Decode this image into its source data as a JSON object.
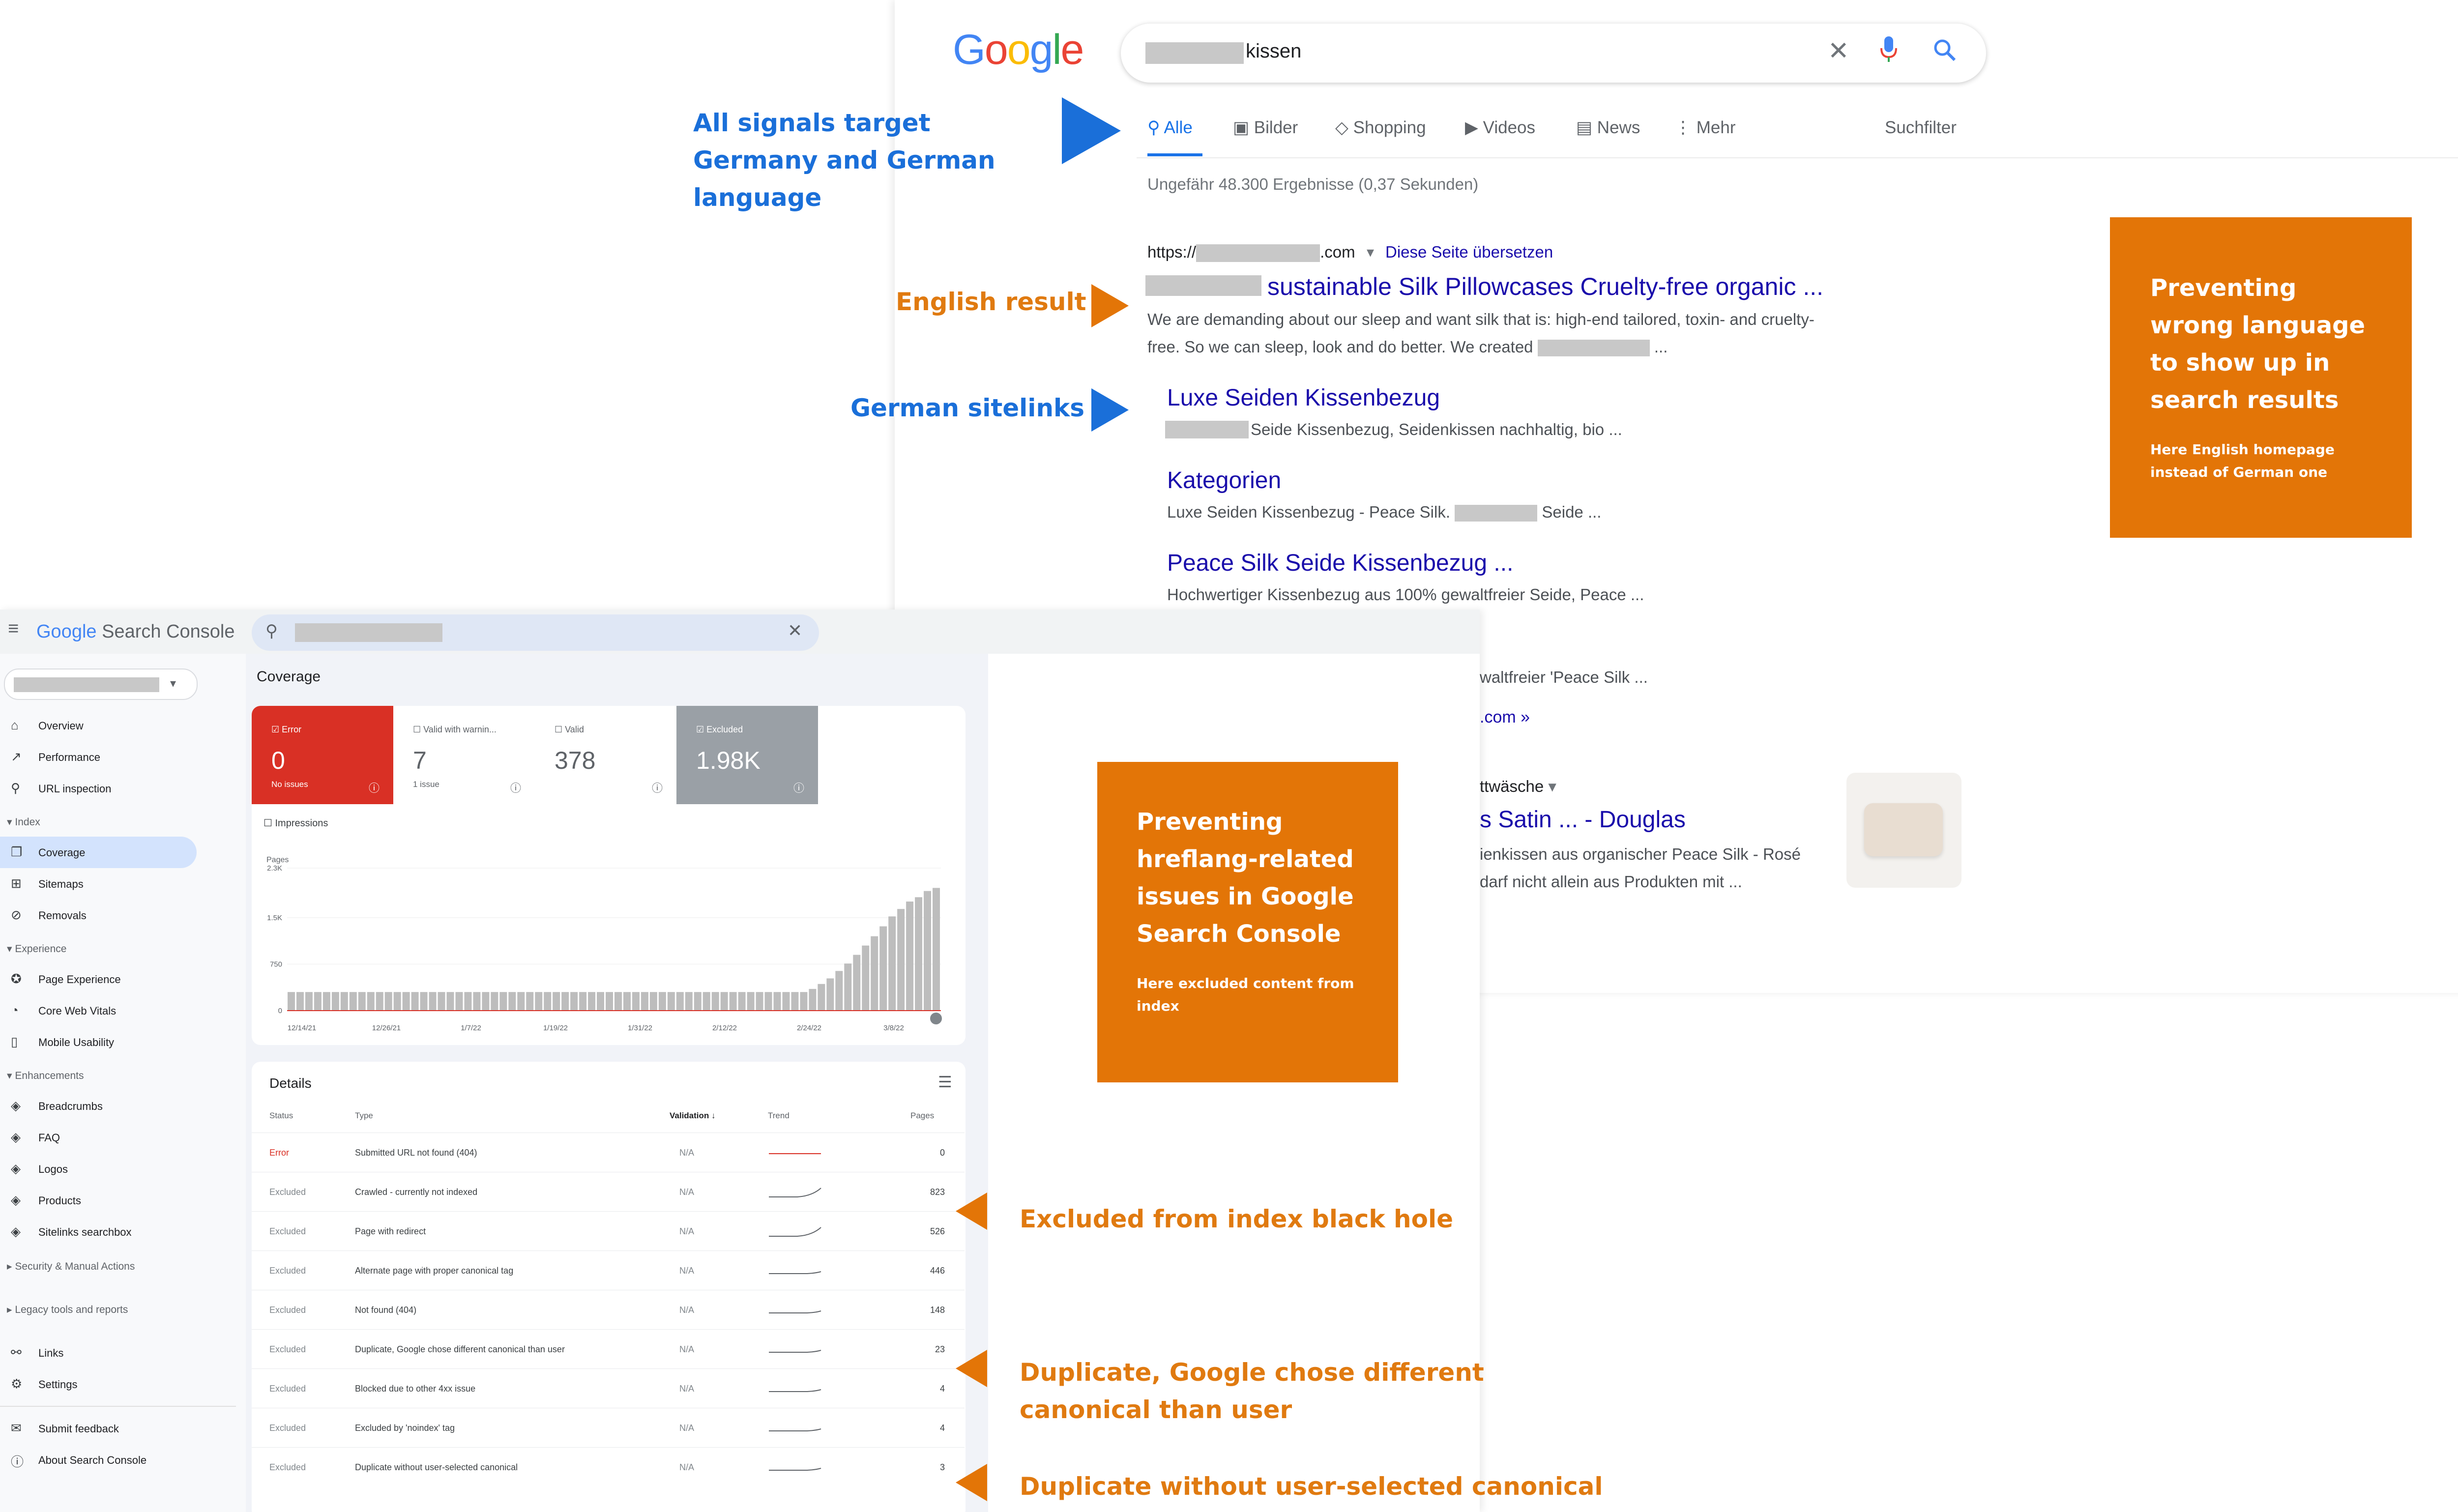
{
  "annotations": {
    "signals": "All signals target Germany and German language",
    "english_result": "English result",
    "german_sitelinks": "German sitelinks",
    "excluded_black_hole": "Excluded from index black hole",
    "duplicate_google_canonical": "Duplicate, Google chose different canonical than user",
    "duplicate_without_canonical": "Duplicate without user-selected canonical",
    "box_language": {
      "title": "Preventing wrong language to show up in search results",
      "subtitle": "Here English homepage instead of German one"
    },
    "box_hreflang": {
      "title": "Preventing hreflang-related issues in Google Search Console",
      "subtitle": "Here excluded content from index"
    }
  },
  "serp": {
    "logo": "Google",
    "query": "kissen",
    "tabs": [
      {
        "label": "Alle",
        "icon": "search-icon"
      },
      {
        "label": "Bilder",
        "icon": "image-icon"
      },
      {
        "label": "Shopping",
        "icon": "tag-icon"
      },
      {
        "label": "Videos",
        "icon": "video-icon"
      },
      {
        "label": "News",
        "icon": "news-icon"
      },
      {
        "label": "Mehr",
        "icon": "more-vert-icon"
      }
    ],
    "filter_label": "Suchfilter",
    "result_stats": "Ungefähr 48.300 Ergebnisse (0,37 Sekunden)",
    "result": {
      "url_prefix": "https://",
      "url_suffix": ".com",
      "translate": "Diese Seite übersetzen",
      "title": "sustainable Silk Pillowcases Cruelty-free organic ...",
      "snippet_line1": "We are demanding about our sleep and want silk that is: high-end tailored, toxin- and cruelty-",
      "snippet_line2": "free. So we can sleep, look and do better. We created",
      "snippet_end": "..."
    },
    "sitelinks": [
      {
        "title": "Luxe Seiden Kissenbezug",
        "desc": "Seide Kissenbezug, Seidenkissen nachhaltig, bio ..."
      },
      {
        "title": "Kategorien",
        "desc_a": "Luxe Seiden Kissenbezug - Peace Silk.",
        "desc_b": "Seide ..."
      },
      {
        "title": "Peace Silk Seide Kissenbezug ...",
        "desc": "Hochwertiger Kissenbezug aus 100% gewaltfreier Seide, Peace ..."
      }
    ],
    "partial": {
      "line1": "waltfreier 'Peace Silk ...",
      "line2": ".com »",
      "line3": "ttwäsche",
      "line4": "s Satin ... - Douglas",
      "line5": "ienkissen aus organischer Peace Silk - Rosé",
      "line6": "darf nicht allein aus Produkten mit ..."
    }
  },
  "gsc": {
    "brand_google": "Google",
    "brand_product": "Search Console",
    "nav_top": [
      {
        "label": "Overview",
        "icon": "home-icon"
      },
      {
        "label": "Performance",
        "icon": "trending-up-icon"
      },
      {
        "label": "URL inspection",
        "icon": "search-icon"
      }
    ],
    "section_index": "Index",
    "nav_index": [
      {
        "label": "Coverage",
        "icon": "file-copy-icon"
      },
      {
        "label": "Sitemaps",
        "icon": "sitemap-icon"
      },
      {
        "label": "Removals",
        "icon": "eye-off-icon"
      }
    ],
    "section_experience": "Experience",
    "nav_experience": [
      {
        "label": "Page Experience",
        "icon": "star-circle-icon"
      },
      {
        "label": "Core Web Vitals",
        "icon": "speed-icon"
      },
      {
        "label": "Mobile Usability",
        "icon": "phone-icon"
      }
    ],
    "section_enhancements": "Enhancements",
    "nav_enhancements": [
      {
        "label": "Breadcrumbs",
        "icon": "layers-icon"
      },
      {
        "label": "FAQ",
        "icon": "layers-icon"
      },
      {
        "label": "Logos",
        "icon": "layers-icon"
      },
      {
        "label": "Products",
        "icon": "layers-icon"
      },
      {
        "label": "Sitelinks searchbox",
        "icon": "layers-icon"
      }
    ],
    "section_security": "Security & Manual Actions",
    "section_legacy": "Legacy tools and reports",
    "nav_bottom": [
      {
        "label": "Links",
        "icon": "links-icon"
      },
      {
        "label": "Settings",
        "icon": "gear-icon"
      }
    ],
    "nav_footer": [
      {
        "label": "Submit feedback",
        "icon": "feedback-icon"
      },
      {
        "label": "About Search Console",
        "icon": "info-icon"
      }
    ],
    "page_title": "Coverage",
    "tiles": [
      {
        "label": "Error",
        "value": "0",
        "sub": "No issues",
        "checked": true
      },
      {
        "label": "Valid with warnin...",
        "value": "7",
        "sub": "1 issue",
        "checked": false
      },
      {
        "label": "Valid",
        "value": "378",
        "sub": "",
        "checked": false
      },
      {
        "label": "Excluded",
        "value": "1.98K",
        "sub": "",
        "checked": true
      }
    ],
    "impressions_label": "Impressions",
    "chart_data": {
      "type": "bar",
      "ylabel": "Pages",
      "ylim": [
        0,
        2300
      ],
      "yticks": [
        "2.3K",
        "1.5K",
        "750",
        "0"
      ],
      "xticks": [
        "12/14/21",
        "12/26/21",
        "1/7/22",
        "1/19/22",
        "1/31/22",
        "2/12/22",
        "2/24/22",
        "3/8/22"
      ],
      "values": [
        300,
        300,
        300,
        300,
        300,
        300,
        300,
        300,
        300,
        300,
        300,
        300,
        300,
        300,
        300,
        300,
        300,
        300,
        300,
        300,
        300,
        300,
        300,
        300,
        300,
        300,
        300,
        300,
        300,
        300,
        300,
        300,
        300,
        300,
        300,
        300,
        300,
        300,
        300,
        300,
        300,
        300,
        300,
        300,
        300,
        300,
        300,
        300,
        300,
        300,
        300,
        300,
        300,
        300,
        300,
        300,
        300,
        300,
        300,
        350,
        430,
        520,
        640,
        760,
        900,
        1050,
        1200,
        1360,
        1520,
        1640,
        1760,
        1830,
        1930,
        1980
      ]
    },
    "details_title": "Details",
    "columns": [
      "Status",
      "Type",
      "Validation",
      "Trend",
      "Pages"
    ],
    "rows": [
      {
        "status": "Error",
        "type": "Submitted URL not found (404)",
        "validation": "N/A",
        "pages": "0"
      },
      {
        "status": "Excluded",
        "type": "Crawled - currently not indexed",
        "validation": "N/A",
        "pages": "823"
      },
      {
        "status": "Excluded",
        "type": "Page with redirect",
        "validation": "N/A",
        "pages": "526"
      },
      {
        "status": "Excluded",
        "type": "Alternate page with proper canonical tag",
        "validation": "N/A",
        "pages": "446"
      },
      {
        "status": "Excluded",
        "type": "Not found (404)",
        "validation": "N/A",
        "pages": "148"
      },
      {
        "status": "Excluded",
        "type": "Duplicate, Google chose different canonical than user",
        "validation": "N/A",
        "pages": "23"
      },
      {
        "status": "Excluded",
        "type": "Blocked due to other 4xx issue",
        "validation": "N/A",
        "pages": "4"
      },
      {
        "status": "Excluded",
        "type": "Excluded by 'noindex' tag",
        "validation": "N/A",
        "pages": "4"
      },
      {
        "status": "Excluded",
        "type": "Duplicate without user-selected canonical",
        "validation": "N/A",
        "pages": "3"
      }
    ]
  },
  "colors": {
    "google_blue": "#1a73e8",
    "link": "#1a0dab",
    "orange": "#e37507",
    "error_red": "#d93025",
    "excluded_grey": "#9aa0a6",
    "coverage_selected": "#d3e3fd"
  }
}
